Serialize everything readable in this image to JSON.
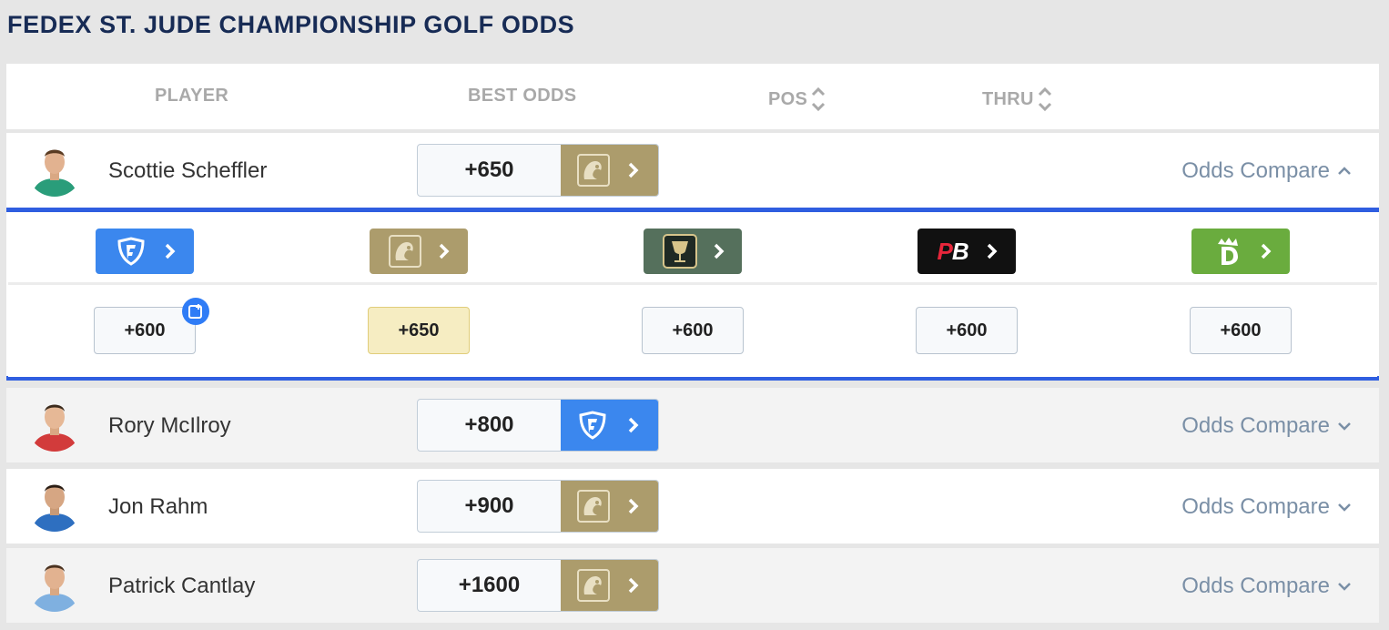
{
  "title": "FEDEX ST. JUDE CHAMPIONSHIP GOLF ODDS",
  "headers": {
    "player": "PLAYER",
    "best_odds": "BEST ODDS",
    "pos": "POS",
    "thru": "THRU"
  },
  "compare_label": "Odds Compare",
  "colors": {
    "fanduel": "#3b87ee",
    "betmgm": "#ac9c6c",
    "caesars": "#55705c",
    "pointsbet": "#111111",
    "draftkings": "#6aac3e",
    "accent_line": "#2f5ee0",
    "title": "#172b55"
  },
  "players": [
    {
      "name": "Scottie Scheffler",
      "best_odds": "+650",
      "book": "betmgm",
      "expanded": true,
      "shirt": "#2a9d7a"
    },
    {
      "name": "Rory McIlroy",
      "best_odds": "+800",
      "book": "fanduel",
      "expanded": false,
      "shirt": "#d23b3b"
    },
    {
      "name": "Jon Rahm",
      "best_odds": "+900",
      "book": "betmgm",
      "expanded": false,
      "shirt": "#2e6fc0"
    },
    {
      "name": "Patrick Cantlay",
      "best_odds": "+1600",
      "book": "betmgm",
      "expanded": false,
      "shirt": "#7fb0e0"
    }
  ],
  "compare": {
    "books": [
      {
        "name": "fanduel",
        "icon": "fanduel-shield-icon"
      },
      {
        "name": "betmgm",
        "icon": "betmgm-lion-icon"
      },
      {
        "name": "caesars",
        "icon": "caesars-goblet-icon"
      },
      {
        "name": "pointsbet",
        "icon": "pointsbet-logo-icon",
        "label": "PB"
      },
      {
        "name": "draftkings",
        "icon": "draftkings-crown-icon"
      }
    ],
    "prices": [
      "+600",
      "+650",
      "+600",
      "+600",
      "+600"
    ],
    "best_index": 1
  }
}
